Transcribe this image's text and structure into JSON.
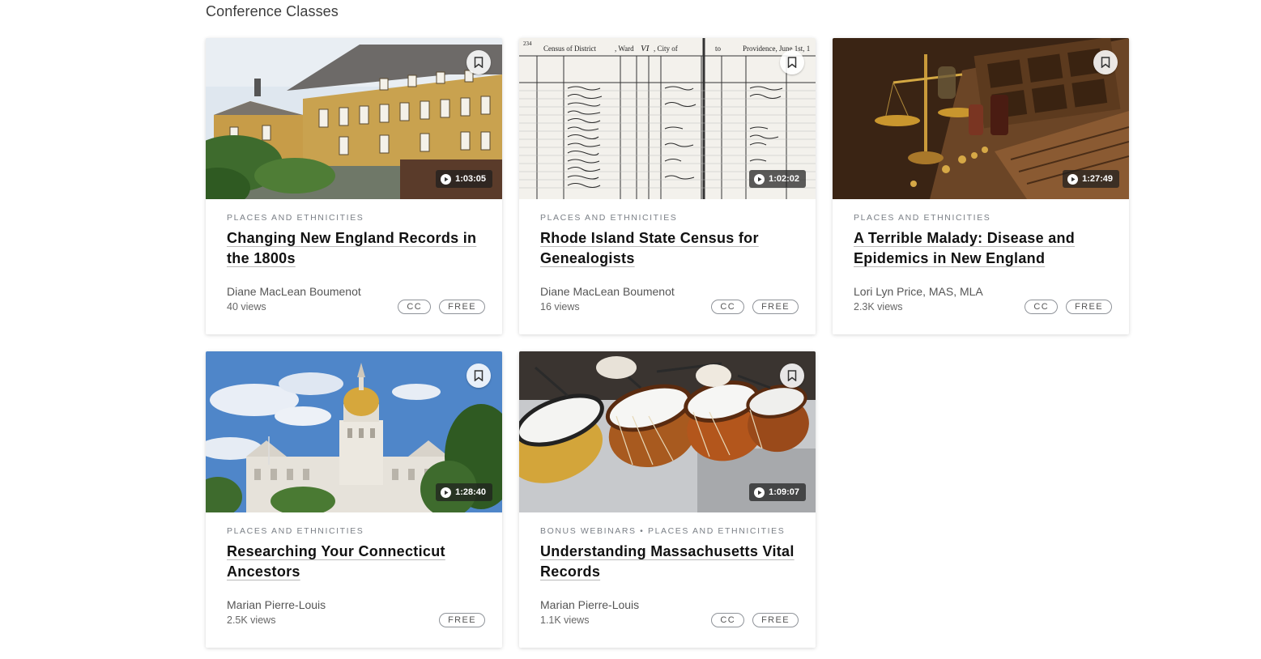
{
  "section_title": "Conference Classes",
  "cards": [
    {
      "category": "PLACES AND ETHNICITIES",
      "title": "Changing New England Records in the 1800s",
      "author": "Diane MacLean Boumenot",
      "views": "40 views",
      "duration": "1:03:05",
      "badges": [
        "CC",
        "FREE"
      ]
    },
    {
      "category": "PLACES AND ETHNICITIES",
      "title": "Rhode Island State Census for Genealogists",
      "author": "Diane MacLean Boumenot",
      "views": "16 views",
      "duration": "1:02:02",
      "badges": [
        "CC",
        "FREE"
      ],
      "census_header": [
        "234",
        "Census of District",
        ", Ward",
        "VI",
        ", City of",
        "to",
        "Providence, June 1st, 1"
      ]
    },
    {
      "category": "PLACES AND ETHNICITIES",
      "title": "A Terrible Malady: Disease and Epidemics in New England",
      "author": "Lori Lyn Price, MAS, MLA",
      "views": "2.3K views",
      "duration": "1:27:49",
      "badges": [
        "CC",
        "FREE"
      ]
    },
    {
      "category": "PLACES AND ETHNICITIES",
      "title": "Researching Your Connecticut Ancestors",
      "author": "Marian Pierre-Louis",
      "views": "2.5K views",
      "duration": "1:28:40",
      "badges": [
        "FREE"
      ]
    },
    {
      "category": "BONUS WEBINARS  •  PLACES AND ETHNICITIES",
      "title": "Understanding Massachusetts Vital Records",
      "author": "Marian Pierre-Louis",
      "views": "1.1K views",
      "duration": "1:09:07",
      "badges": [
        "CC",
        "FREE"
      ]
    }
  ],
  "icons": {
    "bookmark": "bookmark-icon",
    "play": "play-icon"
  },
  "colors": {
    "duration_bg": "#1e1e1e",
    "badge_border": "#8f9399",
    "category_text": "#7a7f86"
  }
}
